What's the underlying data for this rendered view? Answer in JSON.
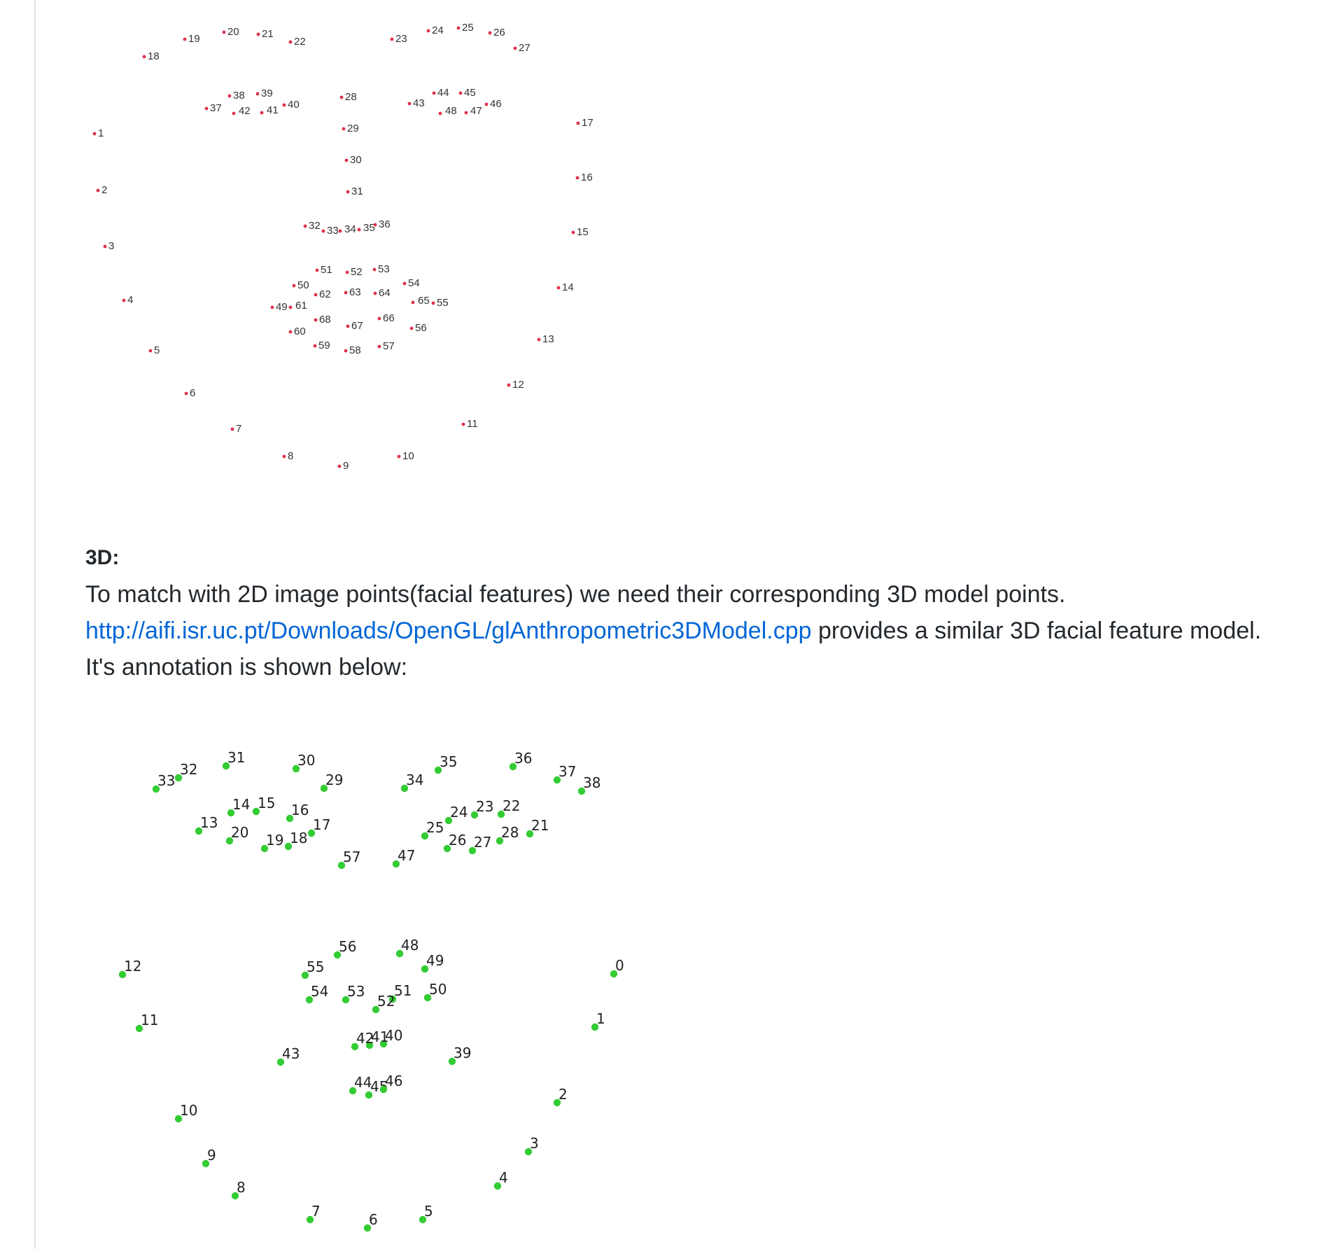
{
  "figure_2d": {
    "label_color": "#333333",
    "marker_color": "#e0304a",
    "points": [
      "1",
      "2",
      "3",
      "4",
      "5",
      "6",
      "7",
      "8",
      "9",
      "10",
      "11",
      "12",
      "13",
      "14",
      "15",
      "16",
      "17",
      "18",
      "19",
      "20",
      "21",
      "22",
      "23",
      "24",
      "25",
      "26",
      "27",
      "28",
      "29",
      "30",
      "31",
      "32",
      "33",
      "34",
      "35",
      "36",
      "37",
      "38",
      "39",
      "40",
      "41",
      "42",
      "43",
      "44",
      "45",
      "46",
      "47",
      "48",
      "49",
      "50",
      "51",
      "52",
      "53",
      "54",
      "55",
      "56",
      "57",
      "58",
      "59",
      "60",
      "61",
      "62",
      "63",
      "64",
      "65",
      "66",
      "67",
      "68"
    ]
  },
  "section": {
    "heading": "3D:",
    "line1": "To match with 2D image points(facial features) we need their corresponding 3D model points.",
    "link_text": "http://aifi.isr.uc.pt/Downloads/OpenGL/glAnthropometric3DModel.cpp",
    "line2_rest": " provides a similar 3D facial feature model.",
    "line3": "It's annotation is shown below:"
  },
  "figure_3d": {
    "marker_color": "#33cc33",
    "label_color": "#222222",
    "points": [
      "0",
      "1",
      "2",
      "3",
      "4",
      "5",
      "6",
      "7",
      "8",
      "9",
      "10",
      "11",
      "12",
      "13",
      "14",
      "15",
      "16",
      "17",
      "18",
      "19",
      "20",
      "21",
      "22",
      "23",
      "24",
      "25",
      "26",
      "27",
      "28",
      "29",
      "30",
      "31",
      "32",
      "33",
      "34",
      "35",
      "36",
      "37",
      "38",
      "39",
      "40",
      "41",
      "42",
      "43",
      "44",
      "45",
      "46",
      "47",
      "48",
      "49",
      "50",
      "51",
      "52",
      "53",
      "54",
      "55",
      "56",
      "57"
    ]
  }
}
